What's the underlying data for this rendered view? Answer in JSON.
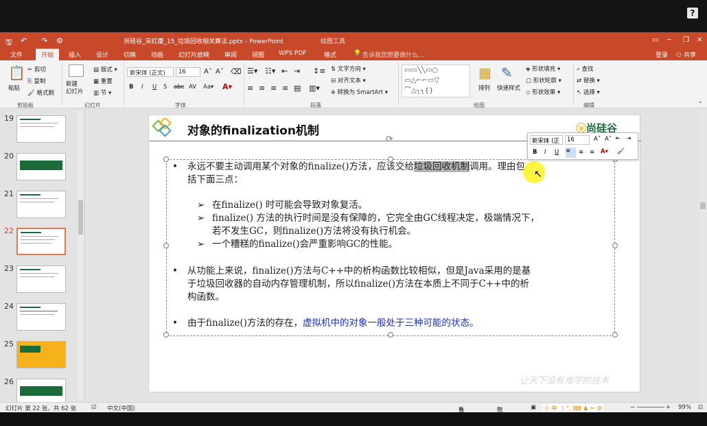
{
  "window": {
    "title": "尚硅谷_宋红康_15_垃圾回收相关算法.pptx - PowerPoint",
    "context_tool": "绘图工具",
    "help_label": "?"
  },
  "tabs": [
    "文件",
    "开始",
    "插入",
    "设计",
    "切换",
    "动画",
    "幻灯片放映",
    "审阅",
    "视图",
    "WPS PDF",
    "格式"
  ],
  "tell_me": "告诉我您想要做什么...",
  "account": {
    "login": "登录",
    "share": "共享"
  },
  "ribbon": {
    "clipboard": {
      "paste": "粘贴",
      "cut": "剪切",
      "copy": "复制",
      "format_painter": "格式刷",
      "label": "剪贴板"
    },
    "slides": {
      "new_slide": "新建\n幻灯片",
      "layout": "版式",
      "reset": "重置",
      "section": "节",
      "label": "幻灯片"
    },
    "font": {
      "font_name": "新宋体 (正文)",
      "font_size": "16",
      "label": "字体"
    },
    "paragraph": {
      "text_direction": "文字方向",
      "align_text": "对齐文本",
      "smartart": "转换为 SmartArt",
      "label": "段落"
    },
    "drawing": {
      "arrange": "排列",
      "quick_styles": "快速样式",
      "shape_fill": "形状填充",
      "shape_outline": "形状轮廓",
      "shape_effects": "形状效果",
      "label": "绘图"
    },
    "editing": {
      "find": "查找",
      "replace": "替换",
      "select": "选择",
      "label": "编辑"
    }
  },
  "thumbnails": [
    {
      "num": "19"
    },
    {
      "num": "20"
    },
    {
      "num": "21"
    },
    {
      "num": "22",
      "active": true
    },
    {
      "num": "23"
    },
    {
      "num": "24"
    },
    {
      "num": "25"
    },
    {
      "num": "26"
    }
  ],
  "slide": {
    "title": "对象的finalization机制",
    "logo": "尚硅谷",
    "watermark": "让天下没有难学的技术",
    "bullet1_a": "永远不要主动调用某个对象的finalize()方法，应该交给",
    "bullet1_highlight": "垃圾回收机制",
    "bullet1_b": "调用。理由包",
    "bullet1_c": "括下面三点：",
    "sub1": "在finalize() 时可能会导致对象复活。",
    "sub2_a": "finalize() 方法的执行时间是没有保障的，它完全由GC线程决定，极端情况下，",
    "sub2_b": "若不发生GC，则finalize()方法将没有执行机会。",
    "sub3": "一个糟糕的finalize()会严重影响GC的性能。",
    "bullet2_a": "从功能上来说，finalize()方法与C++中的析构函数比较相似，但是Java采用的是基",
    "bullet2_b": "于垃圾回收器的自动内存管理机制，所以finalize()方法在本质上不同于C++中的析",
    "bullet2_c": "构函数。",
    "bullet3_a": "由于finalize()方法的存在，",
    "bullet3_b": "虚拟机中的对象一般处于三种可能的状态。",
    "bullet_glyph": "•",
    "arrow_glyph": "➢"
  },
  "mini_toolbar": {
    "font": "新宋体 (正",
    "size": "16"
  },
  "status": {
    "slide_info": "幻灯片 第 22 张，共 62 张",
    "language": "中文(中国)",
    "notes": "备注",
    "comments": "批注",
    "zoom": "99%"
  },
  "colors": {
    "accent": "#c8482a",
    "link_blue": "#1a2fc4",
    "green": "#1b6b3a"
  }
}
